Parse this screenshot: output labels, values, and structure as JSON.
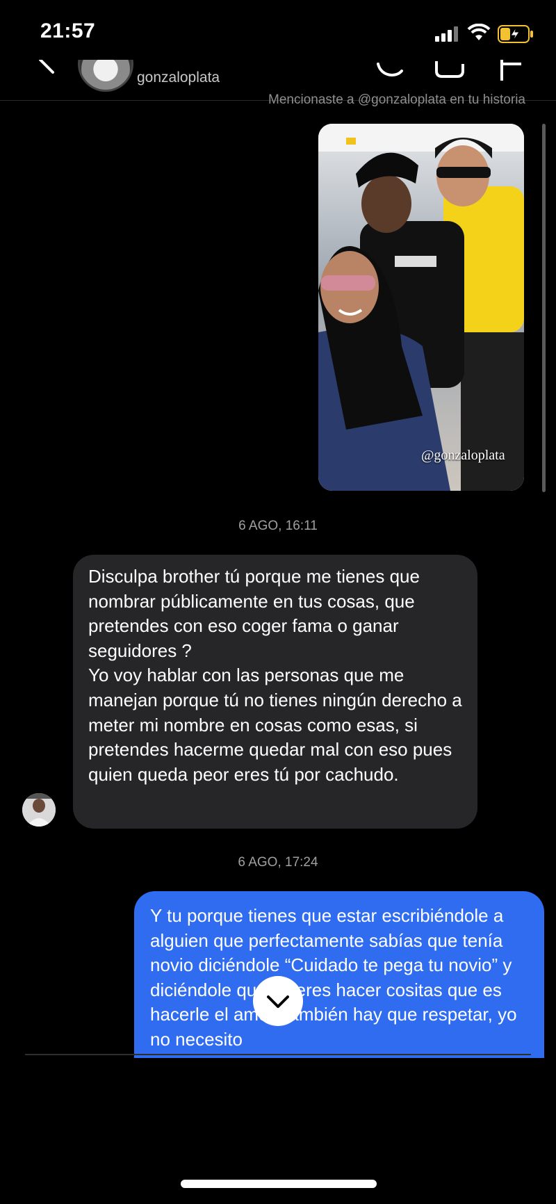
{
  "status_bar": {
    "time": "21:57"
  },
  "header": {
    "username": "gonzaloplata"
  },
  "mention_note": "Mencionaste a @gonzaloplata en tu historia",
  "story": {
    "mention_tag": "@gonzaloplata"
  },
  "messages": [
    {
      "timestamp": "6 AGO, 16:11",
      "direction": "incoming",
      "text": "Disculpa brother tú porque me tienes que nombrar públicamente en tus cosas, que pretendes con eso coger fama o ganar seguidores ?\nYo voy hablar con las personas que me manejan porque tú no tienes ningún derecho a meter mi nombre en cosas como esas, si pretendes hacerme quedar mal con eso pues quien queda peor eres tú por cachudo."
    },
    {
      "timestamp": "6 AGO, 17:24",
      "direction": "outgoing",
      "text": "Y tu porque tienes que estar escribiéndole a alguien que perfectamente sabías que tenía novio diciéndole “Cuidado te pega tu novio” y diciéndole que quieres hacer cositas que es hacerle el amor, también hay que respetar, yo no necesito"
    }
  ],
  "colors": {
    "outgoing_bubble": "#2f6cf0",
    "incoming_bubble": "#262628",
    "background": "#000000"
  },
  "icons": [
    "signal-icon",
    "wifi-icon",
    "battery-charging-icon",
    "back-icon",
    "call-icon",
    "video-icon",
    "flag-icon",
    "chevron-down-icon"
  ]
}
